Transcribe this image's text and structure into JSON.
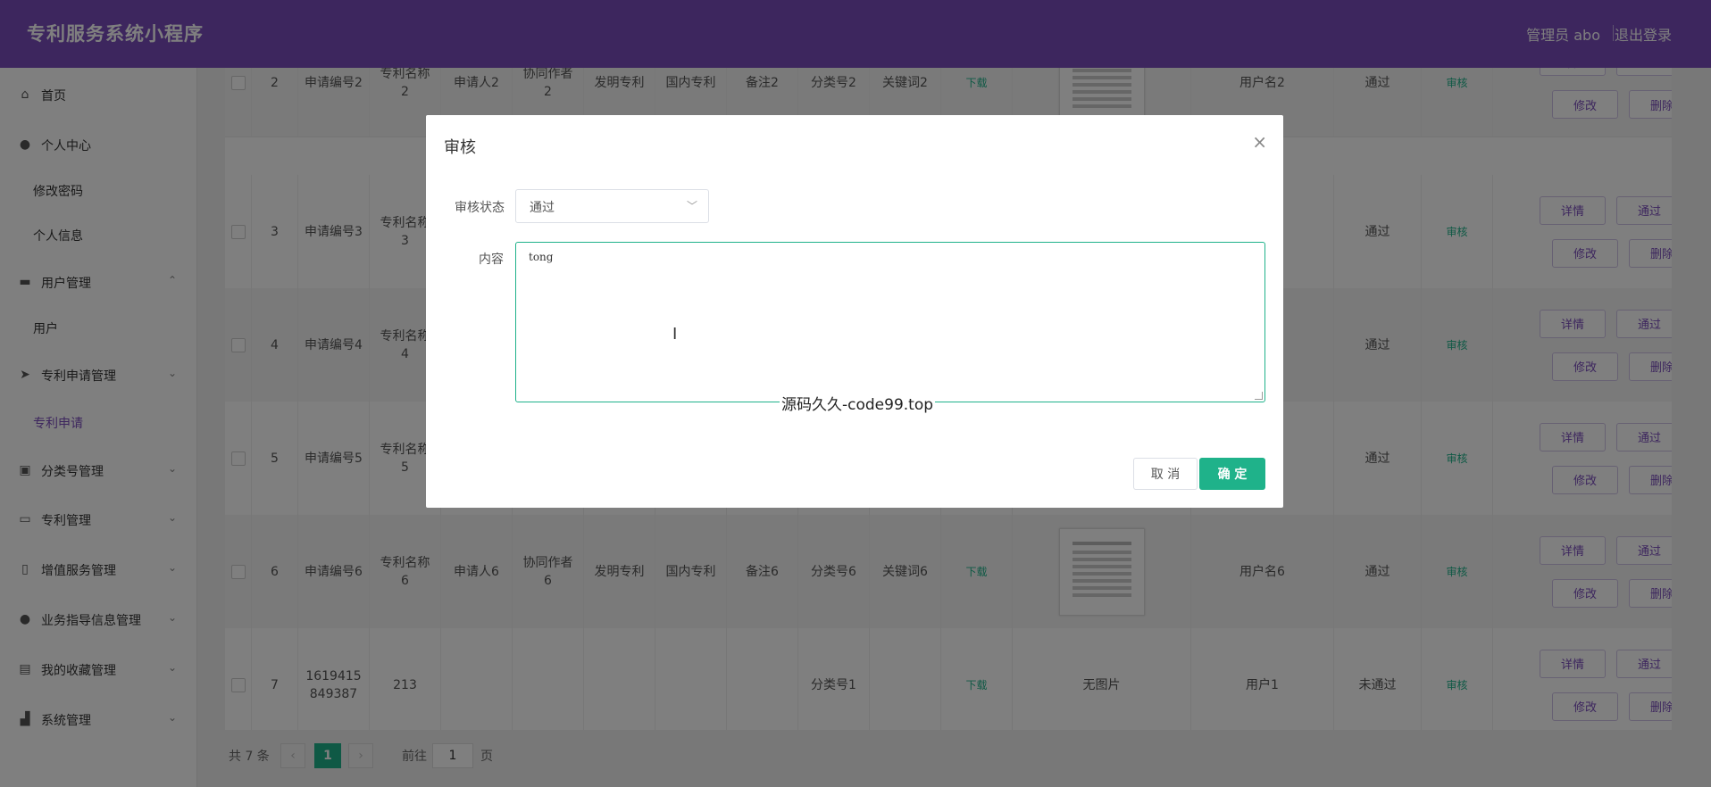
{
  "header": {
    "title": "专利服务系统小程序",
    "user": "管理员 abo",
    "logout": "退出登录"
  },
  "sidebar": {
    "items": [
      {
        "label": "首页",
        "icon": "home-icon",
        "top": 0
      },
      {
        "label": "个人中心",
        "icon": "user-icon"
      },
      {
        "label": "修改密码",
        "sub": true
      },
      {
        "label": "个人信息",
        "sub": true
      },
      {
        "label": "用户管理",
        "icon": "briefcase-icon",
        "arrow": "⌃"
      },
      {
        "label": "用户",
        "sub": true
      },
      {
        "label": "专利申请管理",
        "icon": "send-icon",
        "arrow": "⌄"
      },
      {
        "label": "专利申请",
        "sub": true,
        "active": true
      },
      {
        "label": "分类号管理",
        "icon": "box-icon",
        "arrow": "⌄"
      },
      {
        "label": "专利管理",
        "icon": "card-icon",
        "arrow": "⌄"
      },
      {
        "label": "增值服务管理",
        "icon": "battery-icon",
        "arrow": "⌄"
      },
      {
        "label": "业务指导信息管理",
        "icon": "location-icon",
        "arrow": "⌄"
      },
      {
        "label": "我的收藏管理",
        "icon": "bookmark-icon",
        "arrow": "⌄"
      },
      {
        "label": "系统管理",
        "icon": "chart-icon",
        "arrow": "⌄"
      }
    ]
  },
  "table": {
    "rows": [
      {
        "idx": "2",
        "apply_no": "申请编号2",
        "name": "专利名称2",
        "applicant": "申请人2",
        "coauthor": "协同作者2",
        "type": "发明专利",
        "region": "国内专利",
        "note": "备注2",
        "cls": "分类号2",
        "kw": "关键词2",
        "download": "下载",
        "img": true,
        "user": "用户名2",
        "status": "通过",
        "audit": "审核"
      },
      {
        "idx": "3",
        "apply_no": "申请编号3",
        "name": "专利名称3",
        "applicant": "",
        "coauthor": "",
        "type": "",
        "region": "",
        "note": "",
        "cls": "",
        "kw": "",
        "download": "",
        "img": false,
        "user": "",
        "status": "通过",
        "audit": "审核"
      },
      {
        "idx": "4",
        "apply_no": "申请编号4",
        "name": "专利名称4",
        "applicant": "",
        "coauthor": "",
        "type": "",
        "region": "",
        "note": "",
        "cls": "",
        "kw": "",
        "download": "",
        "img": false,
        "user": "",
        "status": "通过",
        "audit": "审核"
      },
      {
        "idx": "5",
        "apply_no": "申请编号5",
        "name": "专利名称5",
        "applicant": "",
        "coauthor": "",
        "type": "",
        "region": "",
        "note": "",
        "cls": "",
        "kw": "",
        "download": "",
        "img": false,
        "user": "",
        "status": "通过",
        "audit": "审核"
      },
      {
        "idx": "6",
        "apply_no": "申请编号6",
        "name": "专利名称6",
        "applicant": "申请人6",
        "coauthor": "协同作者6",
        "type": "发明专利",
        "region": "国内专利",
        "note": "备注6",
        "cls": "分类号6",
        "kw": "关键词6",
        "download": "下载",
        "img": true,
        "user": "用户名6",
        "status": "通过",
        "audit": "审核"
      },
      {
        "idx": "7",
        "apply_no": "1619415849387",
        "name": "213",
        "applicant": "",
        "coauthor": "",
        "type": "",
        "region": "",
        "note": "",
        "cls": "分类号1",
        "kw": "",
        "download": "下载",
        "img": false,
        "img_text": "无图片",
        "user": "用户1",
        "status": "未通过",
        "audit": "审核"
      }
    ],
    "actions": {
      "detail": "详情",
      "pass": "通过",
      "edit": "修改",
      "delete": "删除"
    }
  },
  "pager": {
    "total": "共 7 条",
    "current": "1",
    "goto": "前往",
    "page_input": "1",
    "page_unit": "页"
  },
  "dialog": {
    "title": "审核",
    "status_label": "审核状态",
    "status_value": "通过",
    "content_label": "内容",
    "content_value": "tong",
    "cancel": "取 消",
    "confirm": "确 定",
    "watermark": "源码久久-code99.top"
  }
}
